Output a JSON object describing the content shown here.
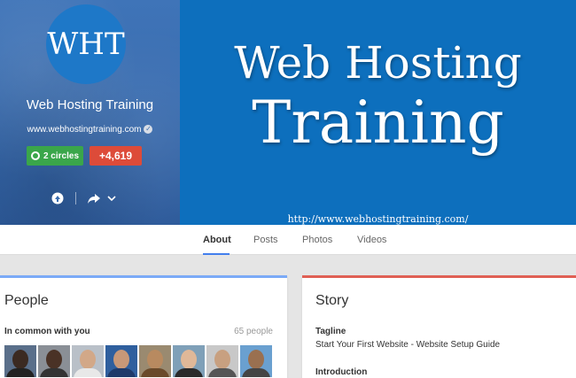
{
  "profile": {
    "avatar_text": "WHT",
    "name": "Web Hosting Training",
    "url": "www.webhostingtraining.com",
    "circles_label": "2 circles",
    "plus_count": "+4,619"
  },
  "cover": {
    "title_line1": "Web Hosting",
    "title_line2": "Training",
    "url": "http://www.webhostingtraining.com/"
  },
  "tabs": [
    {
      "label": "About",
      "active": true
    },
    {
      "label": "Posts",
      "active": false
    },
    {
      "label": "Photos",
      "active": false
    },
    {
      "label": "Videos",
      "active": false
    }
  ],
  "people": {
    "title": "People",
    "common_label": "In common with you",
    "count": "65 people"
  },
  "story": {
    "title": "Story",
    "tagline_label": "Tagline",
    "tagline_value": "Start Your First Website - Website Setup Guide",
    "intro_label": "Introduction"
  },
  "colors": {
    "cover_blue": "#0d6fbd",
    "circles_green": "#3aa64a",
    "plus_red": "#dd4b39",
    "tab_accent": "#427fed",
    "people_accent": "#7baaf7",
    "story_accent": "#e06055"
  }
}
